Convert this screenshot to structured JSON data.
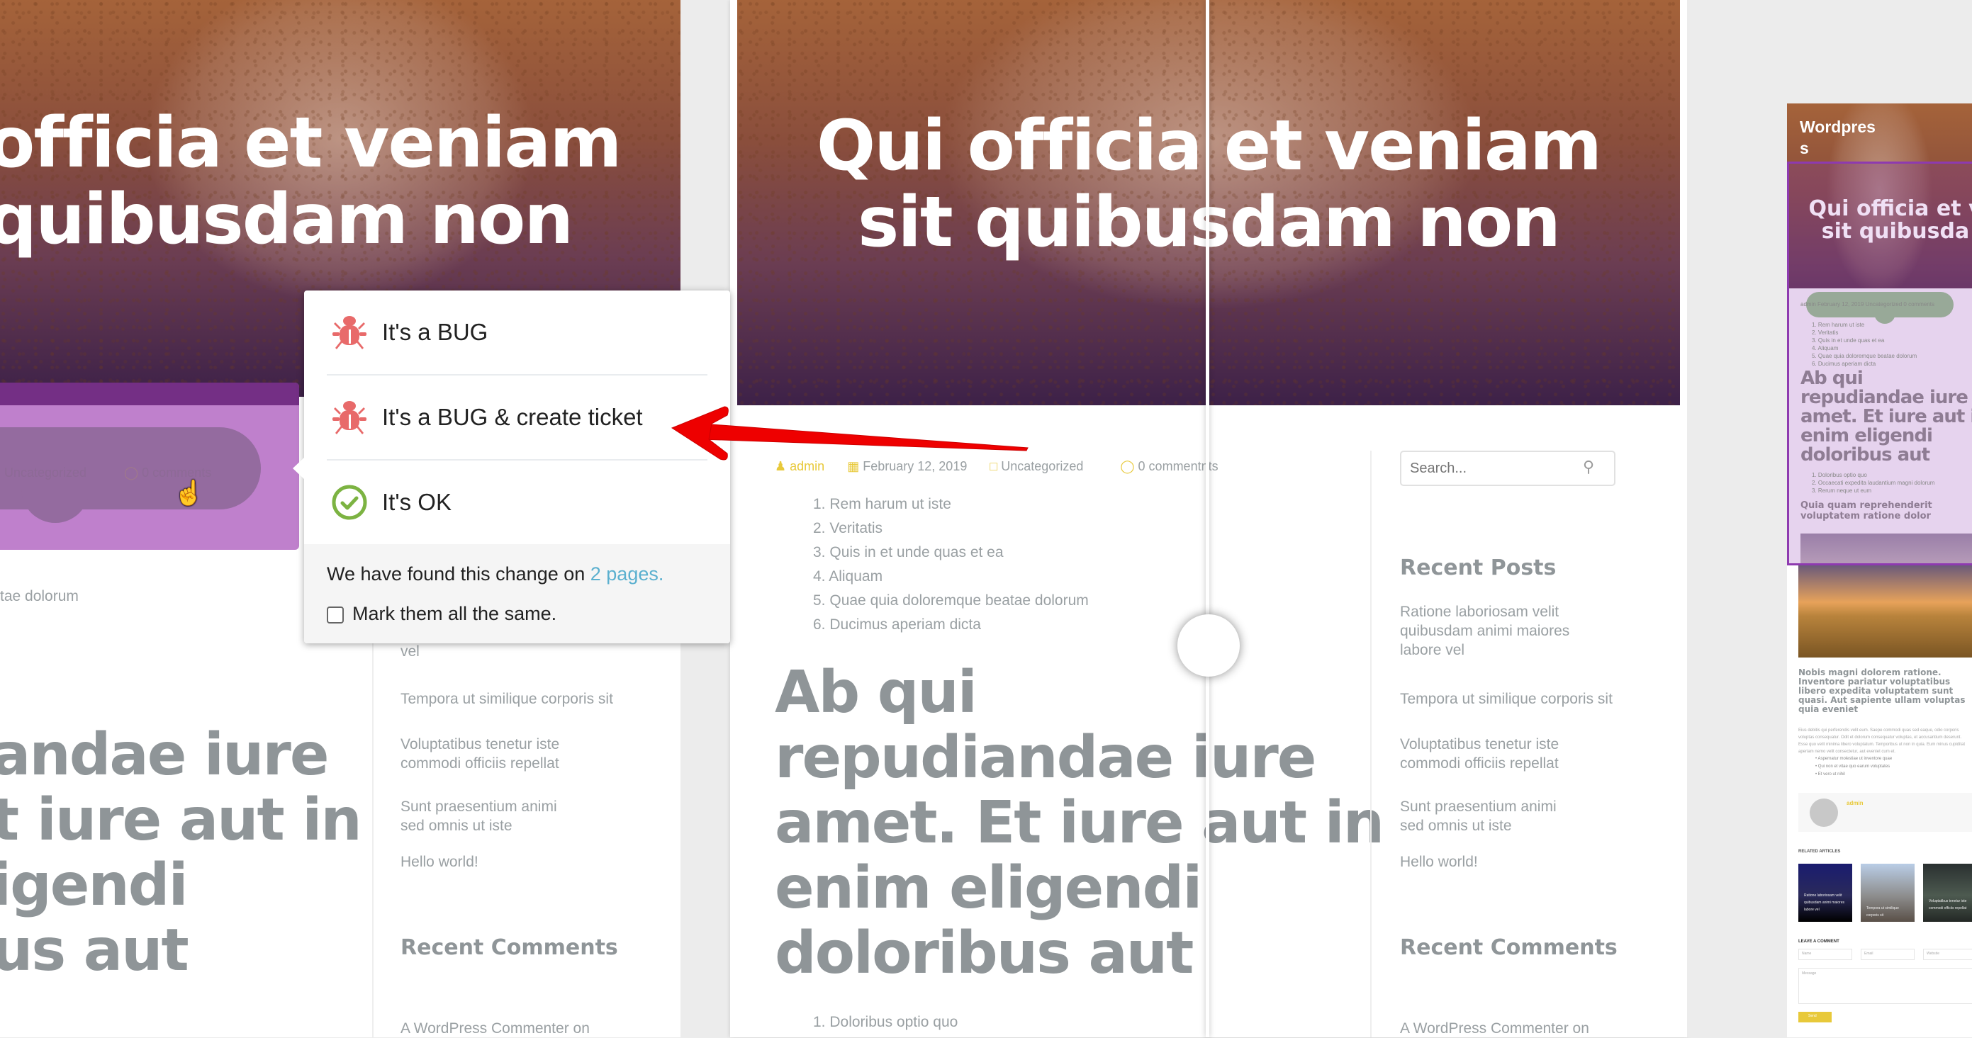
{
  "left_panel": {
    "hero_title_lines": [
      "officia et veniam",
      "quibusdam non"
    ],
    "meta": {
      "category": "Uncategorized",
      "comments": "0 comments"
    },
    "list_tail": "tae dolorum",
    "heading_lines": [
      "andae iure",
      "t iure aut in",
      "igendi",
      "us aut"
    ],
    "sidebar": {
      "recent_posts_tail": "vel",
      "recent_posts": [
        "Tempora ut similique corporis sit",
        "Voluptatibus tenetur iste commodi officiis repellat",
        "Sunt praesentium animi sed omnis ut iste",
        "Hello world!"
      ],
      "recent_comments_title": "Recent Comments",
      "recent_comment": "A WordPress Commenter on"
    }
  },
  "popup": {
    "options": [
      {
        "label": "It's a BUG",
        "icon": "bug-icon"
      },
      {
        "label": "It's a BUG & create ticket",
        "icon": "bug-icon"
      },
      {
        "label": "It's OK",
        "icon": "check-circle-icon"
      }
    ],
    "found_text": "We have found this change on ",
    "found_link": "2 pages.",
    "mark_all_label": "Mark them all the same.",
    "mark_all_checked": false
  },
  "middle_panel": {
    "hero_title_lines": [
      "Qui officia et veniam",
      "sit quibusdam non"
    ],
    "meta": {
      "author": "admin",
      "date": "February 12, 2019",
      "category": "Uncategorized",
      "comments": "0 comment",
      "comments_ghost": "nts"
    },
    "ordered_list": [
      "Rem harum ut iste",
      "Veritatis",
      "Quis in et unde quas et ea",
      "Aliquam",
      "Quae quia doloremque beatae dolorum",
      "Ducimus aperiam dicta"
    ],
    "heading_lines": [
      "Ab qui",
      "repudiandae iure",
      "amet. Et iure aut in",
      "enim eligendi",
      "doloribus aut"
    ],
    "ordered_list_2": [
      "Doloribus optio quo"
    ],
    "sidebar": {
      "search_placeholder": "Search...",
      "recent_posts_title": "Recent Posts",
      "recent_posts": [
        "Ratione laboriosam velit quibusdam animi maiores labore vel",
        "Tempora ut similique corporis sit",
        "Voluptatibus tenetur iste commodi officiis repellat",
        "Sunt praesentium animi sed omnis ut iste",
        "Hello world!"
      ],
      "recent_comments_title": "Recent Comments",
      "recent_comment": "A WordPress Commenter on"
    }
  },
  "thumbnail": {
    "site_title_lines": [
      "Wordpres",
      "s"
    ],
    "hero_title_lines": [
      "Qui officia et v",
      "sit quibusda"
    ],
    "meta": "admin   February 12, 2019   Uncategorized   0 comments",
    "list": [
      "1. Rem harum ut iste",
      "2. Veritatis",
      "3. Quis in et unde quas et ea",
      "4. Aliquam",
      "5. Quae quia doloremque beatae dolorum",
      "6. Ducimus aperiam dicta"
    ],
    "heading_lines": [
      "Ab qui",
      "repudiandae iure",
      "amet. Et iure aut in",
      "enim eligendi",
      "doloribus aut"
    ],
    "list2": [
      "1. Doloribus optio quo",
      "2. Occaecati expedita laudantium magni dolorum",
      "3. Rerum neque ut eum"
    ],
    "subheading": "Quia quam reprehenderit voluptatem ratione dolor",
    "article_title": "Nobis magni dolorem ratione. Inventore pariatur voluptatibus libero expedita voluptatem sunt quasi. Aut sapiente ullam voluptas quia eveniet",
    "article_body": "Eius debitis qui perferendis velit eum. Saepe commodi quas sed eaque, odio corporis voluptas consequatur. Odit et dolorum consequatur voluptas, et accusantium deserunt. Esse quo velit minima libero voluptatum. Temporibus ut non in quia. Eum minus cupiditat aperiam nemo velit consectetur, aut eveniet cum et.",
    "bullets": [
      "Aspernatur molestiae ut inventore quae",
      "Qui non et vitae quo earum voluptates",
      "Et vero ut nihil"
    ],
    "author": "admin",
    "related_title": "RELATED ARTICLES",
    "related": [
      "Ratione laboriosam velit quibusdam animi maiores labore vel",
      "Tempora ut similique corporis sit",
      "Voluptatibus tenetur iste commodi officiis repellat"
    ],
    "comment_title": "LEAVE A COMMENT",
    "name_placeholder": "Name",
    "email_placeholder": "Email",
    "website_placeholder": "Website",
    "message_placeholder": "Message",
    "send_label": "Send"
  },
  "colors": {
    "highlight_purple": "#bf80cc",
    "thumb_highlight": "#e6d3ee",
    "thumb_border": "#8e3ab0",
    "arrow_red": "#ee0000",
    "bug_red": "#e86a6a",
    "ok_green": "#7cb342",
    "link_blue": "#5bb0cf",
    "meta_yellow": "#e8c93a"
  }
}
